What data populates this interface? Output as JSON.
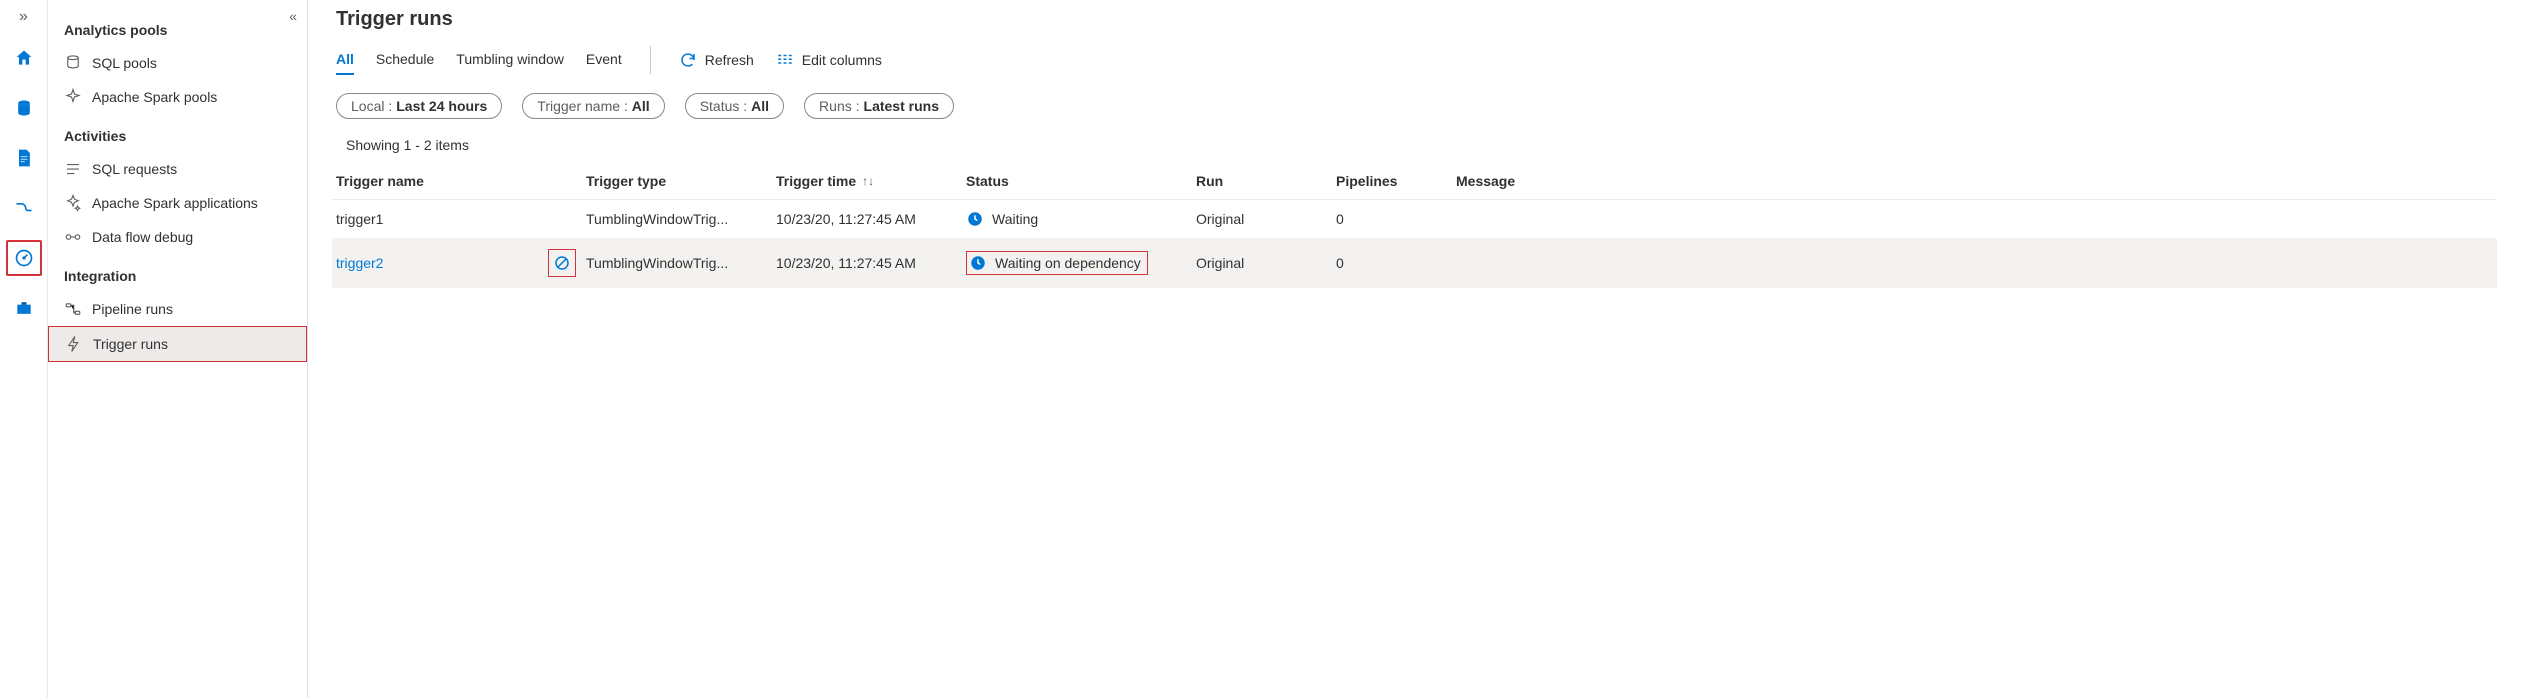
{
  "rail": {
    "items": [
      "home",
      "database",
      "document",
      "pipeline",
      "monitor",
      "toolbox"
    ],
    "selected": "monitor"
  },
  "sidebar": {
    "sections": [
      {
        "header": "Analytics pools",
        "items": [
          {
            "label": "SQL pools",
            "icon": "sql-icon"
          },
          {
            "label": "Apache Spark pools",
            "icon": "spark-icon"
          }
        ]
      },
      {
        "header": "Activities",
        "items": [
          {
            "label": "SQL requests",
            "icon": "sql-req-icon"
          },
          {
            "label": "Apache Spark applications",
            "icon": "spark-app-icon"
          },
          {
            "label": "Data flow debug",
            "icon": "flow-icon"
          }
        ]
      },
      {
        "header": "Integration",
        "items": [
          {
            "label": "Pipeline runs",
            "icon": "pipeline-runs-icon"
          },
          {
            "label": "Trigger runs",
            "icon": "trigger-runs-icon",
            "selected": true,
            "highlight": true
          }
        ]
      }
    ]
  },
  "page": {
    "title": "Trigger runs",
    "tabs": [
      {
        "label": "All",
        "active": true
      },
      {
        "label": "Schedule"
      },
      {
        "label": "Tumbling window"
      },
      {
        "label": "Event"
      }
    ],
    "tools": {
      "refresh": "Refresh",
      "editColumns": "Edit columns"
    },
    "filters": [
      {
        "lead": "Local : ",
        "val": "Last 24 hours"
      },
      {
        "lead": "Trigger name : ",
        "val": "All"
      },
      {
        "lead": "Status : ",
        "val": "All"
      },
      {
        "lead": "Runs : ",
        "val": "Latest runs"
      }
    ],
    "showing": "Showing 1 - 2 items",
    "columns": [
      "Trigger name",
      "Trigger type",
      "Trigger time",
      "Status",
      "Run",
      "Pipelines",
      "Message"
    ],
    "sortColumn": "Trigger time",
    "rows": [
      {
        "name": "trigger1",
        "type": "TumblingWindowTrig...",
        "time": "10/23/20, 11:27:45 AM",
        "status": "Waiting",
        "run": "Original",
        "pipelines": "0",
        "message": ""
      },
      {
        "name": "trigger2",
        "type": "TumblingWindowTrig...",
        "time": "10/23/20, 11:27:45 AM",
        "status": "Waiting on dependency",
        "run": "Original",
        "pipelines": "0",
        "message": "",
        "hovered": true,
        "link": true,
        "statusHighlight": true,
        "showCancel": true
      }
    ]
  }
}
